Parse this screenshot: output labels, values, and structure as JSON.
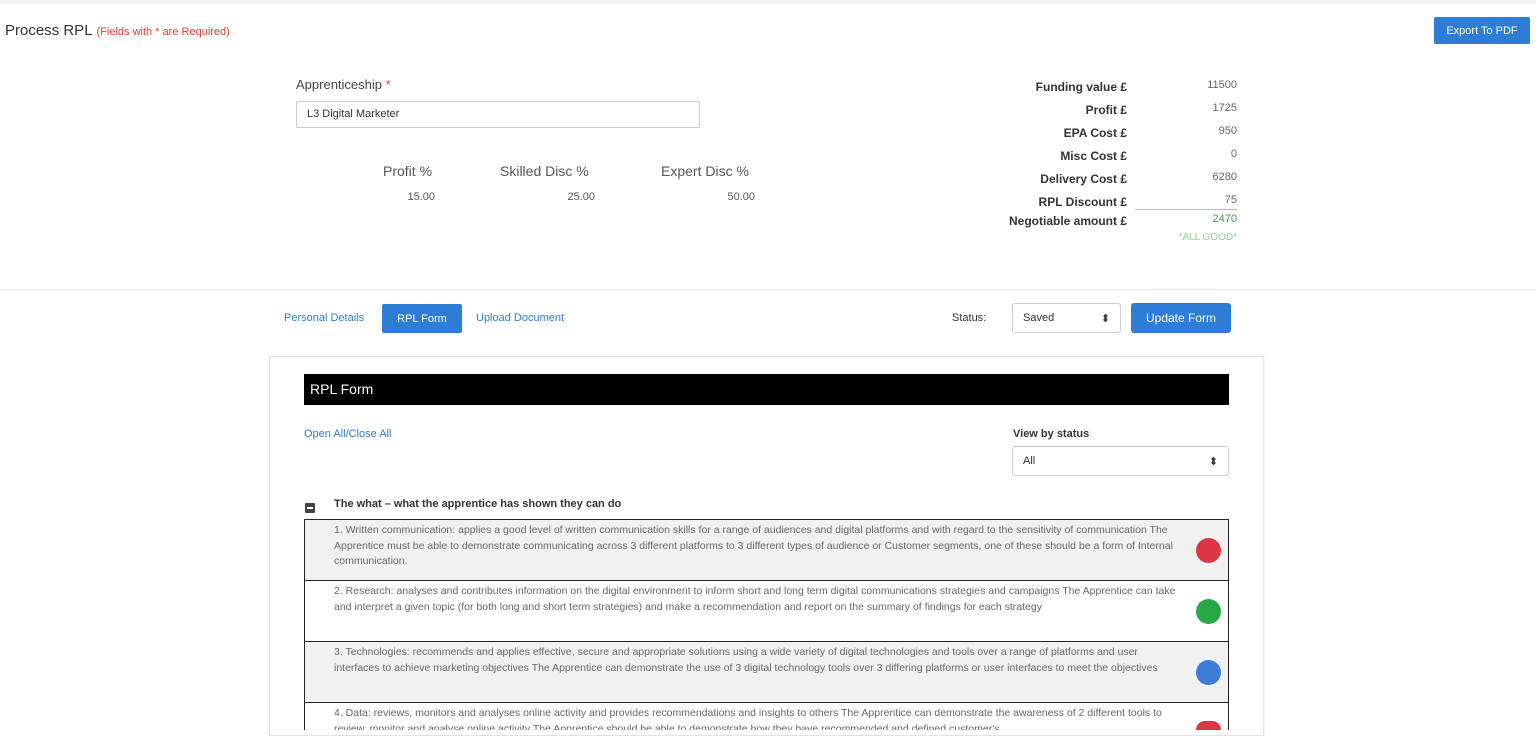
{
  "header": {
    "title": "Process RPL",
    "required_note": "(Fields with * are Required)",
    "export_label": "Export To PDF"
  },
  "apprenticeship": {
    "label": "Apprenticeship",
    "required_mark": "*",
    "value": "L3 Digital Marketer"
  },
  "percentages": [
    {
      "label": "Profit %",
      "value": "15.00"
    },
    {
      "label": "Skilled Disc %",
      "value": "25.00"
    },
    {
      "label": "Expert Disc %",
      "value": "50.00"
    }
  ],
  "finance": [
    {
      "label": "Funding value £",
      "value": "11500"
    },
    {
      "label": "Profit £",
      "value": "1725"
    },
    {
      "label": "EPA Cost £",
      "value": "950"
    },
    {
      "label": "Misc Cost £",
      "value": "0"
    },
    {
      "label": "Delivery Cost £",
      "value": "6280"
    },
    {
      "label": "RPL Discount £",
      "value": "75"
    },
    {
      "label": "Negotiable amount £",
      "value": "2470"
    }
  ],
  "finance_status": "*ALL GOOD*",
  "tabs": {
    "personal": "Personal Details",
    "rpl": "RPL Form",
    "upload": "Upload Document"
  },
  "status": {
    "label": "Status:",
    "value": "Saved",
    "update_label": "Update Form"
  },
  "form": {
    "title": "RPL Form",
    "open_close": "Open All/Close All",
    "view_label": "View by status",
    "view_value": "All",
    "section_title": "The what – what the apprentice has shown they can do",
    "items": [
      {
        "text": "1. Written communication: applies a good level of written communication skills for a range of audiences and digital platforms and with regard to the sensitivity of communication The Apprentice must be able to demonstrate communicating across 3 different platforms to 3 different types of audience or Customer segments, one of these should be a form of Internal communication.",
        "status_color": "#dc3545",
        "bg": "#f1f1f1"
      },
      {
        "text": "2. Research: analyses and contributes information on the digital environment to inform short and long term digital communications strategies and campaigns The Apprentice can take and interpret a given topic (for both long and short term strategies) and make a recommendation and report on the summary of findings for each strategy",
        "status_color": "#28a745",
        "bg": "#ffffff"
      },
      {
        "text": "3. Technologies: recommends and applies effective, secure and appropriate solutions using a wide variety of digital technologies and tools over a range of platforms and user interfaces to achieve marketing objectives The Apprentice can demonstrate the use of 3 digital technology tools over 3 differing platforms or user interfaces to meet the objectives",
        "status_color": "#3b7dd8",
        "bg": "#f1f1f1"
      },
      {
        "text": "4. Data: reviews, monitors and analyses online activity and provides recommendations and insights to others The Apprentice can demonstrate the awareness of 2 different tools to review, monitor and analyse online activity The Apprentice should be able to demonstrate how they have recommended and defined customer's",
        "status_color": "#dc3545",
        "bg": "#ffffff"
      }
    ]
  }
}
